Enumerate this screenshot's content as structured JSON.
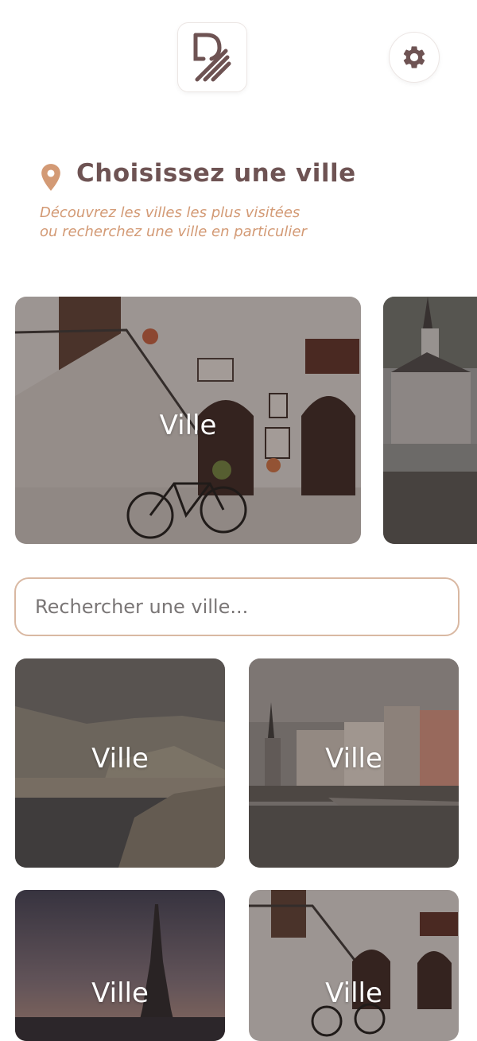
{
  "header": {
    "logo_icon": "app-logo-icon",
    "settings_icon": "gear-icon"
  },
  "intro": {
    "title": "Choisissez une ville",
    "subtitle_line1": "Découvrez les villes les plus visitées",
    "subtitle_line2": "ou recherchez une ville en particulier",
    "pin_icon": "location-pin-icon",
    "accent": "#d39a75",
    "title_color": "#6e5353"
  },
  "featured": [
    {
      "label": "Ville",
      "scene": "street-stairs-bicycle"
    },
    {
      "label": "",
      "scene": "cathedral-river"
    }
  ],
  "search": {
    "placeholder": "Rechercher une ville..."
  },
  "grid": [
    {
      "label": "Ville",
      "scene": "coastal-rocks"
    },
    {
      "label": "Ville",
      "scene": "riverside-buildings"
    },
    {
      "label": "Ville",
      "scene": "eiffel-tower-dusk"
    },
    {
      "label": "Ville",
      "scene": "street-stairs-bicycle"
    }
  ]
}
